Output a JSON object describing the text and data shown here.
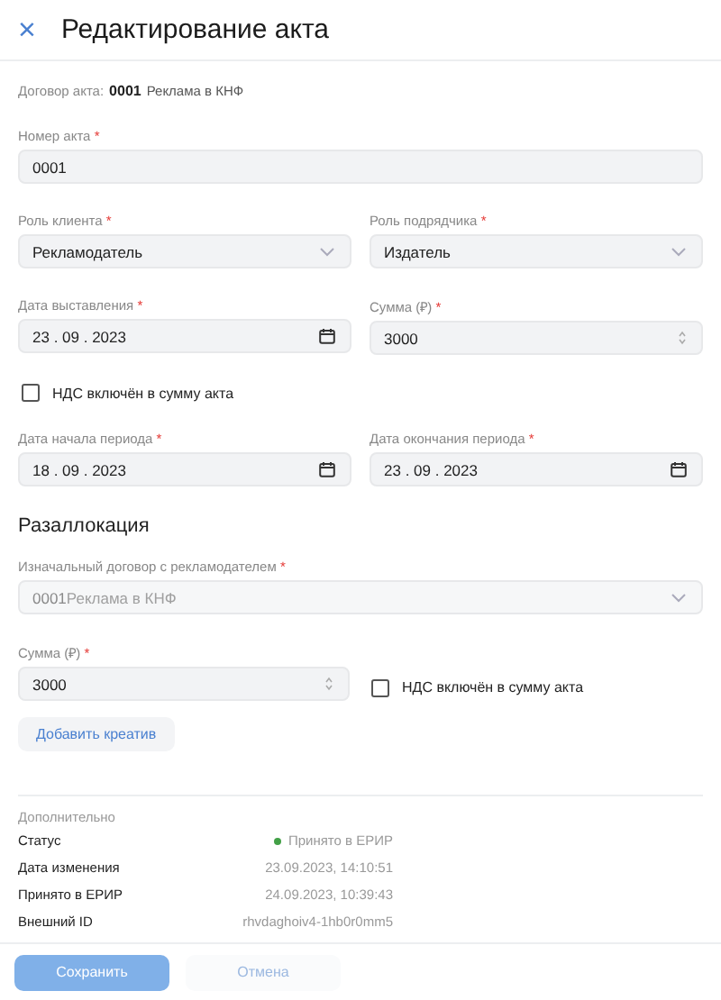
{
  "header": {
    "close": "×",
    "title": "Редактирование акта"
  },
  "contract": {
    "label": "Договор акта:",
    "number": "0001",
    "name": "Реклама в КНФ"
  },
  "rows": [
    {
      "fields": [
        {
          "kind": "text",
          "label": "Номер акта",
          "mark": "*",
          "value": "0001"
        }
      ]
    },
    {
      "fields": [
        {
          "kind": "select",
          "label": "Роль клиента",
          "mark": "*",
          "value": "Рекламодатель"
        },
        {
          "kind": "select",
          "label": "Роль подрядчика",
          "mark": "*",
          "value": "Издатель"
        }
      ]
    },
    {
      "fields": [
        {
          "kind": "date",
          "label": "Дата выставления",
          "mark": "*",
          "value": "23 . 09 . 2023"
        },
        {
          "kind": "number",
          "label": "Сумма (₽)",
          "mark": "*",
          "value": "3000"
        }
      ]
    },
    {
      "fields": [
        {
          "kind": "checkbox",
          "label": "НДС включён в сумму акта",
          "checked": false
        }
      ]
    },
    {
      "fields": [
        {
          "kind": "date",
          "label": "Дата начала периода",
          "mark": "*",
          "value": "18 . 09 . 2023"
        },
        {
          "kind": "date",
          "label": "Дата окончания периода",
          "mark": "*",
          "value": "23 . 09 . 2023"
        }
      ]
    }
  ],
  "reallocation": {
    "title": "Разаллокация",
    "rows": [
      {
        "fields": [
          {
            "kind": "select",
            "label": "Изначальный договор с рекламодателем",
            "mark": "*",
            "value": "0001",
            "note": "Реклама в КНФ",
            "disabled": true
          }
        ]
      },
      {
        "fields": [
          {
            "kind": "number",
            "label": "Сумма (₽)",
            "mark": "*",
            "value": "3000"
          },
          {
            "kind": "checkbox",
            "label": "НДС включён в сумму акта",
            "checked": false
          }
        ]
      }
    ],
    "button": "Добавить креатив"
  },
  "extra": {
    "title": "Дополнительно",
    "rows": [
      {
        "label": "Статус",
        "value": "Принято в ЕРИР",
        "color": "#43a047"
      },
      {
        "label": "Дата изменения",
        "value": "23.09.2023, 14:10:51"
      },
      {
        "label": "Принято в ЕРИР",
        "value": "24.09.2023, 10:39:43"
      },
      {
        "label": "Внешний ID",
        "value": "rhvdaghoiv4-1hb0r0mm5"
      }
    ]
  },
  "footer": [
    {
      "label": "Сохранить",
      "kind": "primary"
    },
    {
      "label": "Отмена",
      "kind": "secondary"
    }
  ]
}
